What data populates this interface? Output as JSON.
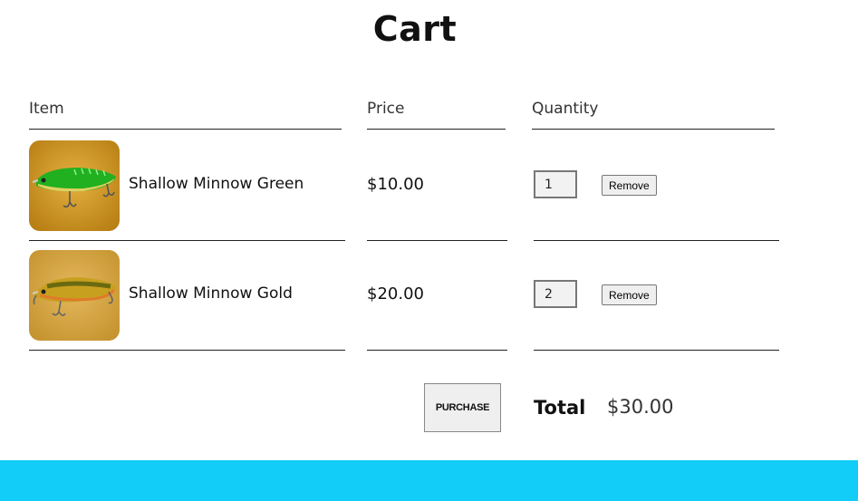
{
  "page": {
    "title": "Cart"
  },
  "table": {
    "headers": {
      "item": "Item",
      "price": "Price",
      "quantity": "Quantity"
    },
    "rows": [
      {
        "name": "Shallow Minnow Green",
        "price": "$10.00",
        "quantity": "1",
        "remove_label": "Remove",
        "image_icon": "green-minnow-lure-photo"
      },
      {
        "name": "Shallow Minnow Gold",
        "price": "$20.00",
        "quantity": "2",
        "remove_label": "Remove",
        "image_icon": "gold-minnow-lure-photo"
      }
    ]
  },
  "footer": {
    "purchase_label": "PURCHASE",
    "total_label": "Total",
    "total_value": "$30.00"
  },
  "colors": {
    "footer_bar": "#12cdf7"
  }
}
